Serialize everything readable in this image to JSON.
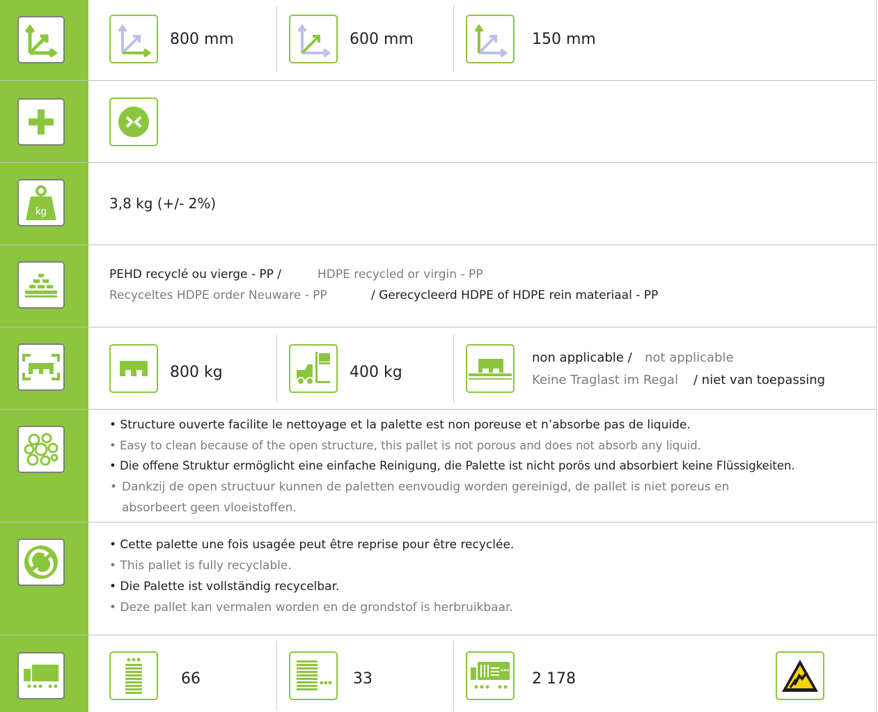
{
  "colors": {
    "accent": "#8cc63f",
    "icon_border": "#7f7f7f",
    "text_dark": "#1e1e1e",
    "text_gray": "#7c7c7c"
  },
  "dimensions": {
    "icon": "dimensions-axes-icon",
    "length": "800 mm",
    "width": "600 mm",
    "height": "150 mm"
  },
  "options": {
    "icon": "plus-icon",
    "items": [
      "nestable-icon"
    ]
  },
  "weight": {
    "icon": "weight-kg-icon",
    "icon_label": "kg",
    "value": "3,8 kg (+/- 2%)"
  },
  "material": {
    "icon": "material-stack-icon",
    "fr": "PEHD recyclé ou vierge - PP /",
    "en": "HDPE recycled or virgin - PP",
    "de": "Recyceltes HDPE order Neuware - PP",
    "nl": "/ Gerecycleerd HDPE of HDPE rein materiaal - PP"
  },
  "load": {
    "icon": "pallet-load-icon",
    "static": "800 kg",
    "dynamic": "400 kg",
    "rack_fr": "non applicable /",
    "rack_en": "not applicable",
    "rack_de": "Keine Traglast im Regal",
    "rack_nl": "/ niet van toepassing"
  },
  "hygiene": {
    "icon": "bubbles-icon",
    "fr": "• Structure ouverte facilite le nettoyage et la palette est non poreuse et n’absorbe pas de liquide.",
    "en": "• Easy to clean because of the open structure, this pallet is not porous and does not absorb any liquid.",
    "de": "• Die offene Struktur ermöglicht eine einfache Reinigung, die Palette ist nicht porös und absorbiert keine Flüssigkeiten.",
    "nl_bullet": "•",
    "nl_line1": "Dankzij de open structuur kunnen de paletten eenvoudig worden gereinigd, de pallet is niet poreus en",
    "nl_line2": "absorbeert geen vloeistoffen."
  },
  "recycling": {
    "icon": "recycle-icon",
    "fr": "• Cette palette une fois usagée peut être reprise pour être recyclée.",
    "en": "• This pallet is fully recyclable.",
    "de": "• Die Palette ist vollständig recycelbar.",
    "nl": "• Deze pallet kan vermalen worden en de grondstof is herbruikbaar."
  },
  "transport": {
    "icon": "truck-icon",
    "per_stack": "66",
    "per_row": "33",
    "per_truck": "2 178",
    "esd_icon": "esd-warning-icon"
  }
}
